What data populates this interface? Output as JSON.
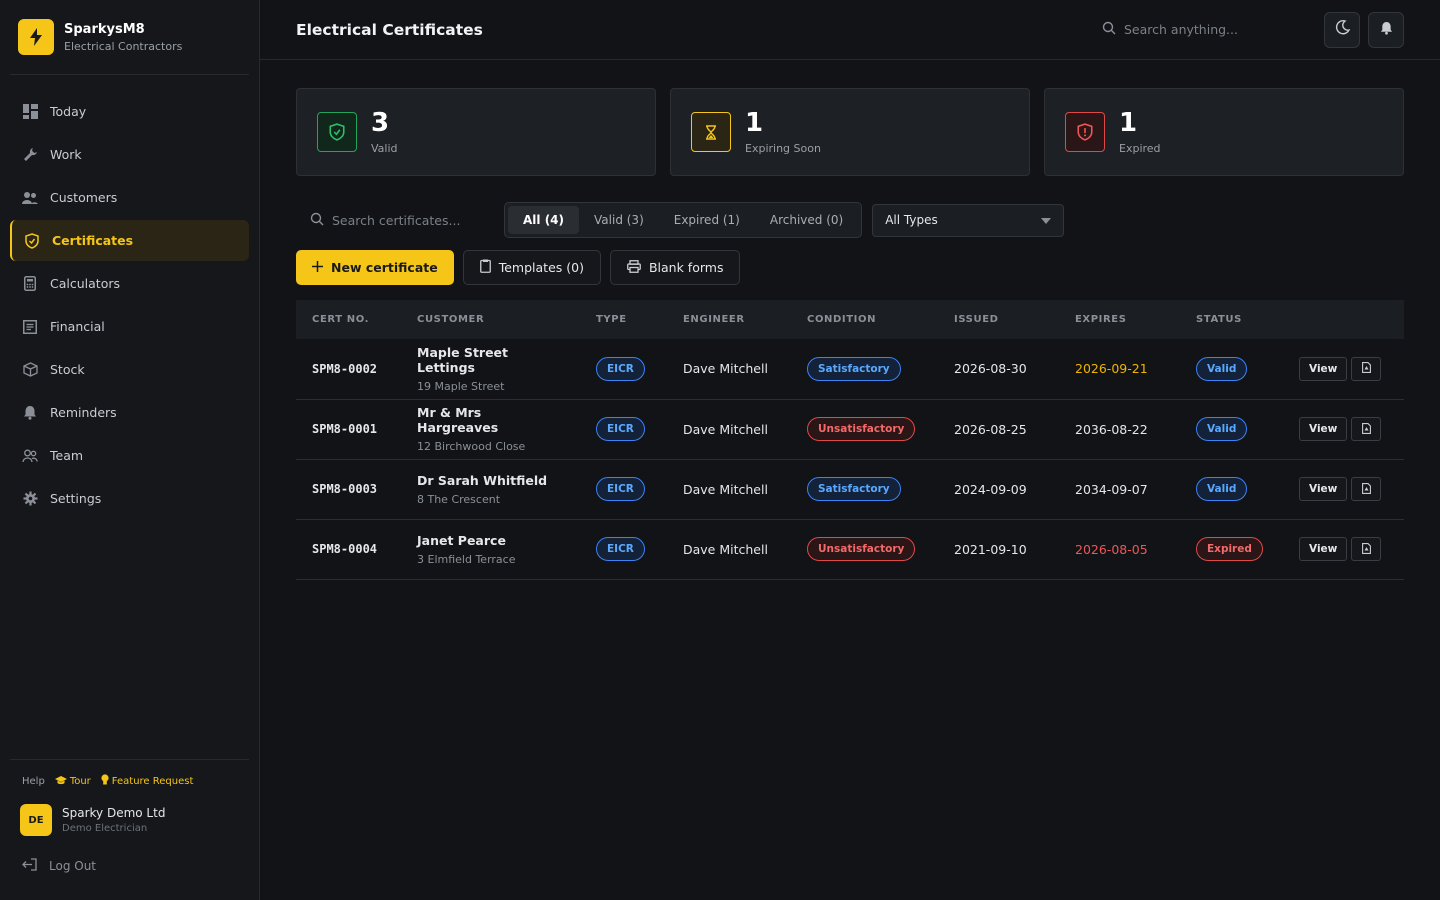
{
  "brand": {
    "name": "SparkysM8",
    "subtitle": "Electrical Contractors"
  },
  "sidebar": {
    "items": [
      {
        "label": "Today",
        "icon": "dashboard-icon"
      },
      {
        "label": "Work",
        "icon": "wrench-icon"
      },
      {
        "label": "Customers",
        "icon": "users-icon"
      },
      {
        "label": "Certificates",
        "icon": "shield-icon",
        "active": true
      },
      {
        "label": "Calculators",
        "icon": "calculator-icon"
      },
      {
        "label": "Financial",
        "icon": "receipt-icon"
      },
      {
        "label": "Stock",
        "icon": "box-icon"
      },
      {
        "label": "Reminders",
        "icon": "bell-icon"
      },
      {
        "label": "Team",
        "icon": "team-icon"
      },
      {
        "label": "Settings",
        "icon": "gear-icon"
      }
    ],
    "help": "Help",
    "tour": "Tour",
    "feature_request": "Feature Request",
    "user": {
      "initials": "DE",
      "name": "Sparky Demo Ltd",
      "role": "Demo Electrician"
    },
    "logout": "Log Out"
  },
  "header": {
    "title": "Electrical Certificates",
    "search_placeholder": "Search anything..."
  },
  "stats": [
    {
      "value": "3",
      "label": "Valid",
      "color": "#22a55a"
    },
    {
      "value": "1",
      "label": "Expiring Soon",
      "color": "#f5c518"
    },
    {
      "value": "1",
      "label": "Expired",
      "color": "#e04848"
    }
  ],
  "filters": {
    "search_placeholder": "Search certificates...",
    "tabs": [
      "All (4)",
      "Valid (3)",
      "Expired (1)",
      "Archived (0)"
    ],
    "type_select": "All Types"
  },
  "actions": {
    "new": "New certificate",
    "templates": "Templates (0)",
    "blank": "Blank forms"
  },
  "table": {
    "columns": [
      "CERT NO.",
      "CUSTOMER",
      "TYPE",
      "ENGINEER",
      "CONDITION",
      "ISSUED",
      "EXPIRES",
      "STATUS"
    ],
    "view_label": "View",
    "rows": [
      {
        "cert": "SPM8-0002",
        "customer": "Maple Street Lettings",
        "address": "19 Maple Street",
        "type": "EICR",
        "engineer": "Dave Mitchell",
        "condition": "Satisfactory",
        "issued": "2026-08-30",
        "expires": "2026-09-21",
        "status": "Valid"
      },
      {
        "cert": "SPM8-0001",
        "customer": "Mr & Mrs Hargreaves",
        "address": "12 Birchwood Close",
        "type": "EICR",
        "engineer": "Dave Mitchell",
        "condition": "Unsatisfactory",
        "issued": "2026-08-25",
        "expires": "2036-08-22",
        "status": "Valid"
      },
      {
        "cert": "SPM8-0003",
        "customer": "Dr Sarah Whitfield",
        "address": "8 The Crescent",
        "type": "EICR",
        "engineer": "Dave Mitchell",
        "condition": "Satisfactory",
        "issued": "2024-09-09",
        "expires": "2034-09-07",
        "status": "Valid"
      },
      {
        "cert": "SPM8-0004",
        "customer": "Janet Pearce",
        "address": "3 Elmfield Terrace",
        "type": "EICR",
        "engineer": "Dave Mitchell",
        "condition": "Unsatisfactory",
        "issued": "2021-09-10",
        "expires": "2026-08-05",
        "status": "Expired"
      }
    ]
  }
}
